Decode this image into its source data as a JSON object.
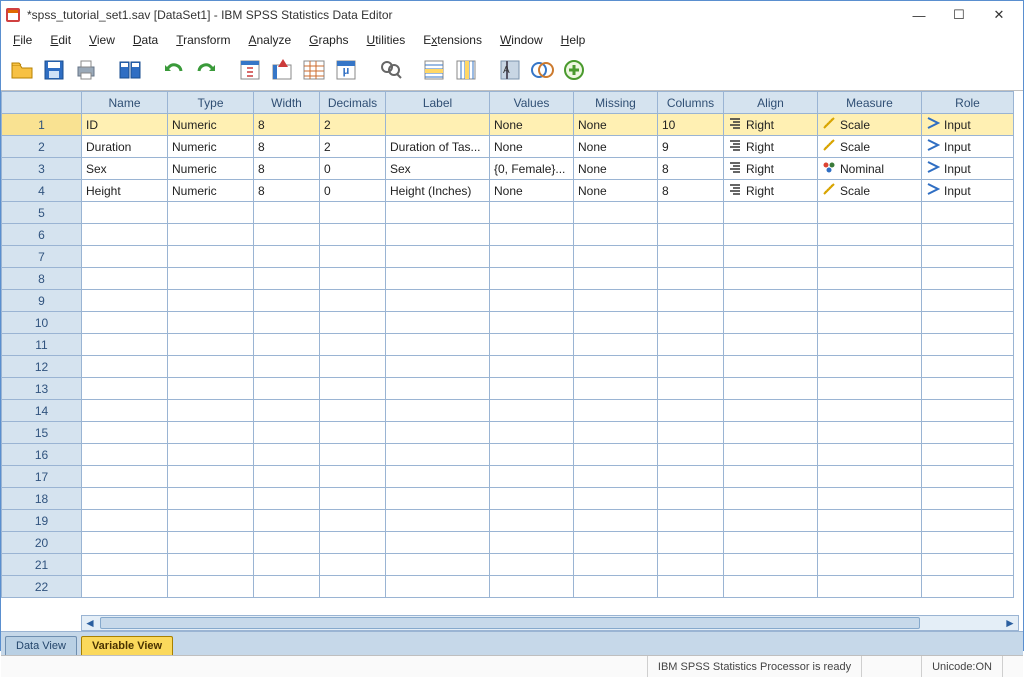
{
  "window": {
    "title": "*spss_tutorial_set1.sav [DataSet1] - IBM SPSS Statistics Data Editor"
  },
  "menu": {
    "items": [
      "File",
      "Edit",
      "View",
      "Data",
      "Transform",
      "Analyze",
      "Graphs",
      "Utilities",
      "Extensions",
      "Window",
      "Help"
    ]
  },
  "columns": {
    "name": "Name",
    "type": "Type",
    "width": "Width",
    "decimals": "Decimals",
    "label": "Label",
    "values": "Values",
    "missing": "Missing",
    "columnsCol": "Columns",
    "align": "Align",
    "measure": "Measure",
    "role": "Role"
  },
  "rows": [
    {
      "n": "1",
      "name": "ID",
      "type": "Numeric",
      "width": "8",
      "decimals": "2",
      "label": "",
      "values": "None",
      "missing": "None",
      "columns": "10",
      "align": "Right",
      "measure": "Scale",
      "role": "Input",
      "selected": true
    },
    {
      "n": "2",
      "name": "Duration",
      "type": "Numeric",
      "width": "8",
      "decimals": "2",
      "label": "Duration of Tas...",
      "values": "None",
      "missing": "None",
      "columns": "9",
      "align": "Right",
      "measure": "Scale",
      "role": "Input"
    },
    {
      "n": "3",
      "name": "Sex",
      "type": "Numeric",
      "width": "8",
      "decimals": "0",
      "label": "Sex",
      "values": "{0, Female}...",
      "missing": "None",
      "columns": "8",
      "align": "Right",
      "measure": "Nominal",
      "role": "Input"
    },
    {
      "n": "4",
      "name": "Height",
      "type": "Numeric",
      "width": "8",
      "decimals": "0",
      "label": "Height (Inches)",
      "values": "None",
      "missing": "None",
      "columns": "8",
      "align": "Right",
      "measure": "Scale",
      "role": "Input"
    }
  ],
  "emptyRows": [
    "5",
    "6",
    "7",
    "8",
    "9",
    "10",
    "11",
    "12",
    "13",
    "14",
    "15",
    "16",
    "17",
    "18",
    "19",
    "20",
    "21",
    "22"
  ],
  "tabs": {
    "data": "Data View",
    "variable": "Variable View"
  },
  "status": {
    "processor": "IBM SPSS Statistics Processor is ready",
    "unicode": "Unicode:ON"
  }
}
